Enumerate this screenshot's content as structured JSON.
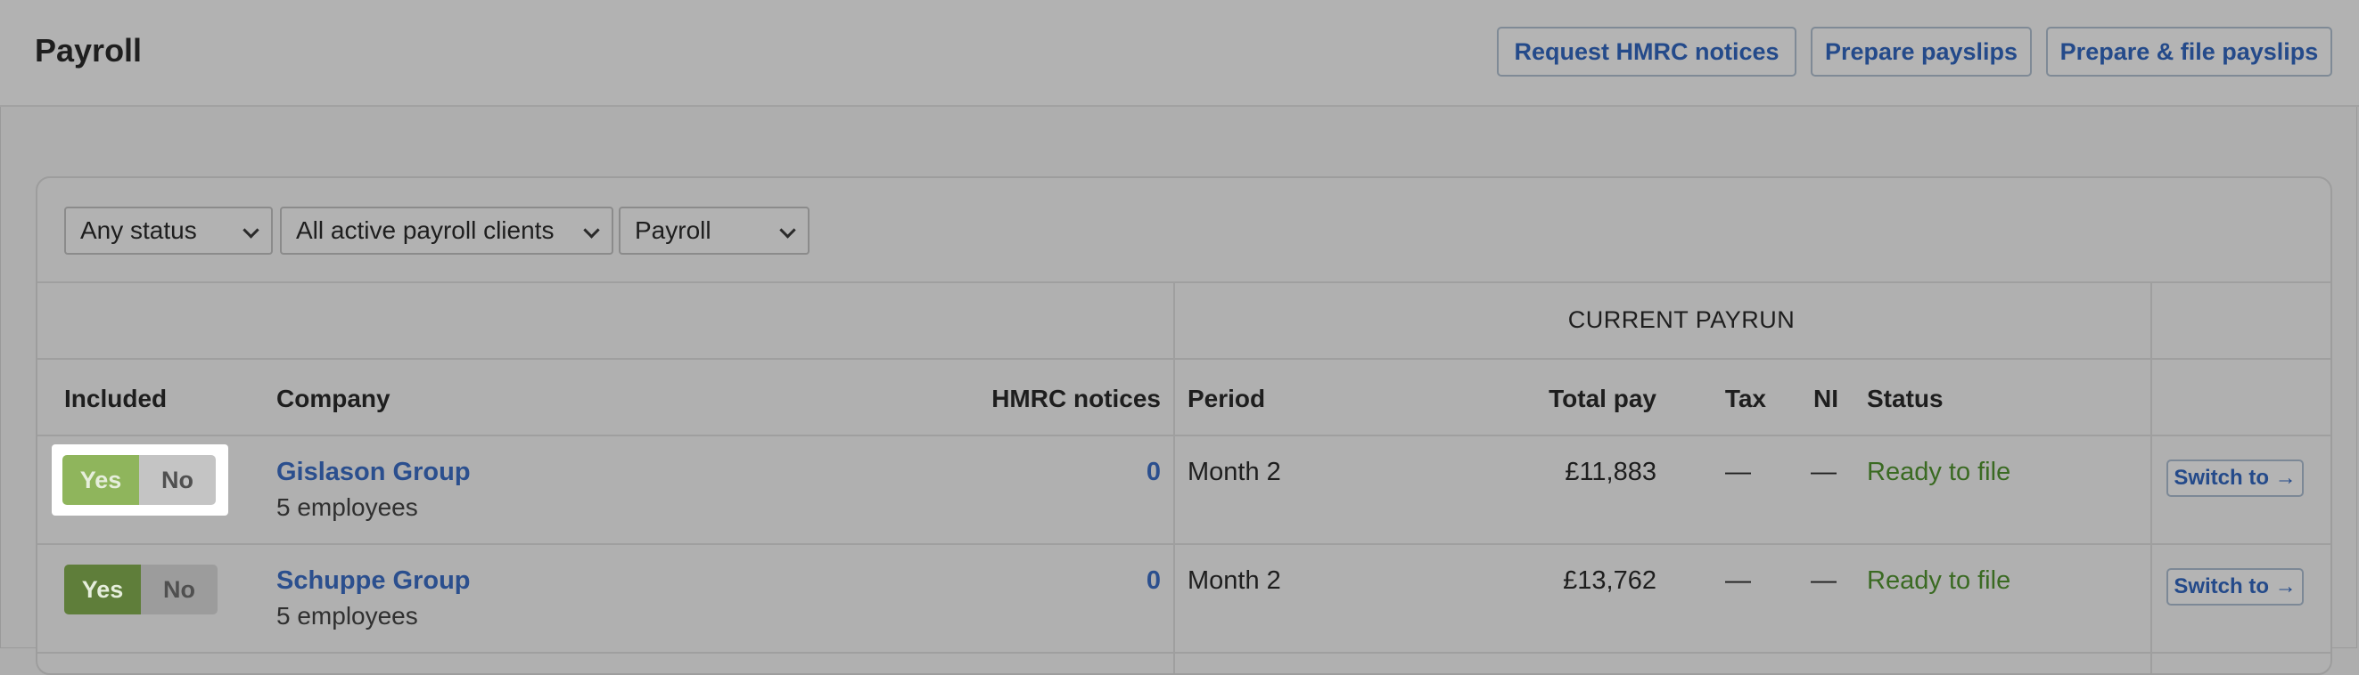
{
  "header": {
    "title": "Payroll",
    "buttons": {
      "request_notices": "Request HMRC notices",
      "prepare_payslips": "Prepare payslips",
      "prepare_file_payslips": "Prepare & file payslips"
    }
  },
  "filters": {
    "status": "Any status",
    "clients": "All active payroll clients",
    "type": "Payroll"
  },
  "table": {
    "group_header": "CURRENT PAYRUN",
    "columns": {
      "included": "Included",
      "company": "Company",
      "notices": "HMRC notices",
      "period": "Period",
      "total_pay": "Total pay",
      "tax": "Tax",
      "ni": "NI",
      "status": "Status"
    },
    "rows": [
      {
        "included_yes": "Yes",
        "included_no": "No",
        "company": "Gislason Group",
        "employees": "5 employees",
        "notices": "0",
        "period": "Month 2",
        "total_pay": "£11,883",
        "tax": "—",
        "ni": "—",
        "status": "Ready to file",
        "action": "Switch to →"
      },
      {
        "included_yes": "Yes",
        "included_no": "No",
        "company": "Schuppe Group",
        "employees": "5 employees",
        "notices": "0",
        "period": "Month 2",
        "total_pay": "£13,762",
        "tax": "—",
        "ni": "—",
        "status": "Ready to file",
        "action": "Switch to →"
      }
    ]
  },
  "colors": {
    "link": "#2b4f8e",
    "status_ready": "#3a6a22",
    "toggle_yes_active": "#8fb55c",
    "toggle_yes": "#5f7e3a"
  }
}
